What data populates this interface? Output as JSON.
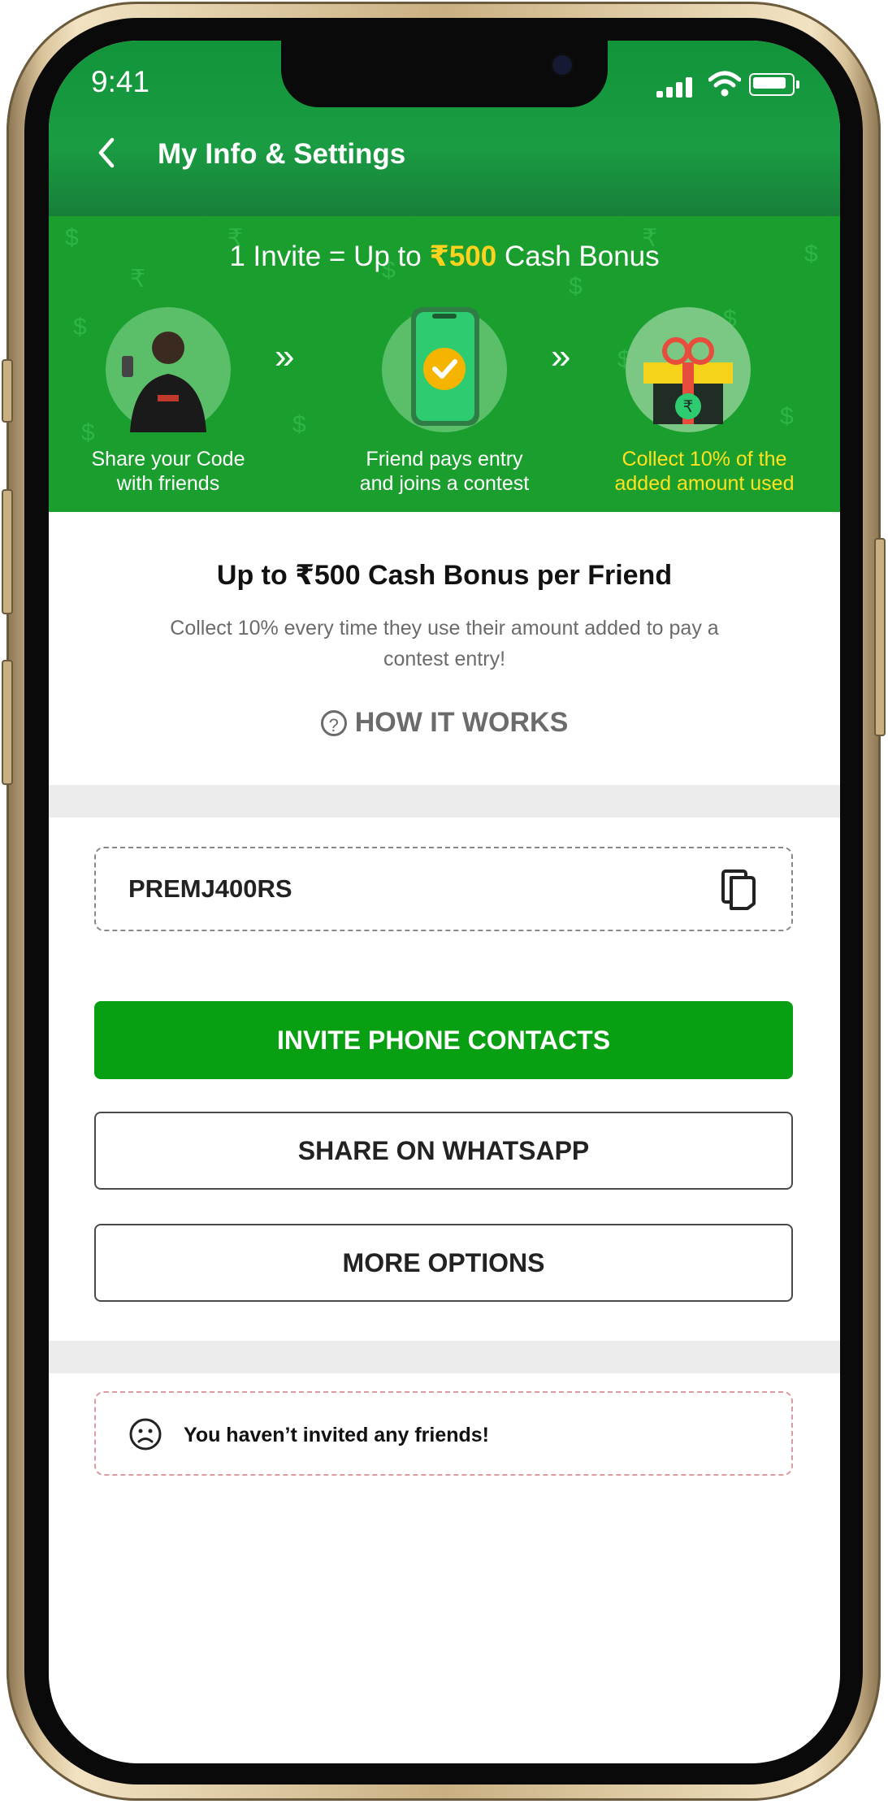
{
  "status_bar": {
    "time": "9:41"
  },
  "nav": {
    "title": "My Info & Settings"
  },
  "banner": {
    "title_prefix": "1 Invite = Up to ",
    "title_amount": "₹500",
    "title_suffix": " Cash Bonus",
    "steps": [
      {
        "line1": "Share your Code",
        "line2": "with friends"
      },
      {
        "line1": "Friend pays entry",
        "line2": "and joins a contest"
      },
      {
        "line1": "Collect 10% of the",
        "line2": "added amount used"
      }
    ],
    "step_text_color": "#ffffff",
    "highlight_color": "#ffe21f"
  },
  "bonus": {
    "title": "Up to ₹500 Cash Bonus per Friend",
    "description": "Collect 10% every time they use their amount added to pay a contest entry!",
    "how_it_works_label": "HOW IT WORKS",
    "how_icon": "help-circle-icon"
  },
  "referral": {
    "code": "PREMJ400RS",
    "copy_icon": "copy-icon"
  },
  "actions": {
    "invite_contacts_label": "INVITE PHONE CONTACTS",
    "share_whatsapp_label": "SHARE ON WHATSAPP",
    "more_options_label": "MORE OPTIONS"
  },
  "friends": {
    "empty_message": "You haven’t invited any friends!",
    "icon": "sad-face-icon"
  },
  "colors": {
    "header_green": "#11943a",
    "banner_green": "#1a9f2e",
    "primary_button": "#08a012",
    "amount_yellow": "#ffd21f"
  }
}
